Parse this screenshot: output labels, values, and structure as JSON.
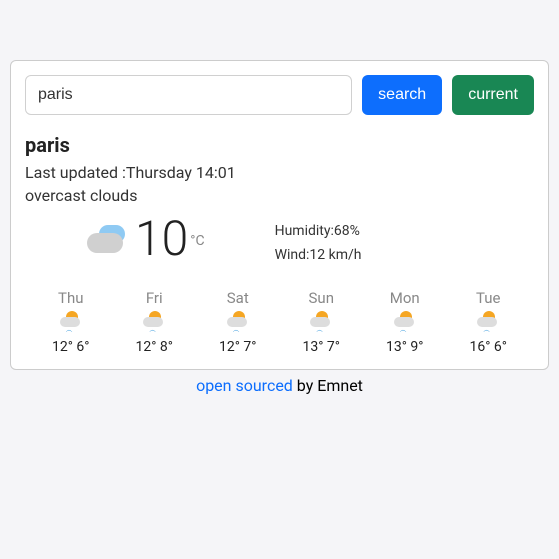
{
  "search": {
    "value": "paris",
    "search_label": "search",
    "current_label": "current"
  },
  "weather": {
    "city": "paris",
    "last_updated": "Last updated :Thursday 14:01",
    "description": "overcast clouds",
    "temp": "10",
    "unit": "°C",
    "humidity": "Humidity:68%",
    "wind": "Wind:12 km/h"
  },
  "forecast": [
    {
      "day": "Thu",
      "hi": "12°",
      "lo": "6°"
    },
    {
      "day": "Fri",
      "hi": "12°",
      "lo": "8°"
    },
    {
      "day": "Sat",
      "hi": "12°",
      "lo": "7°"
    },
    {
      "day": "Sun",
      "hi": "13°",
      "lo": "7°"
    },
    {
      "day": "Mon",
      "hi": "13°",
      "lo": "9°"
    },
    {
      "day": "Tue",
      "hi": "16°",
      "lo": "6°"
    }
  ],
  "footer": {
    "link": "open sourced",
    "rest": " by Emnet"
  }
}
